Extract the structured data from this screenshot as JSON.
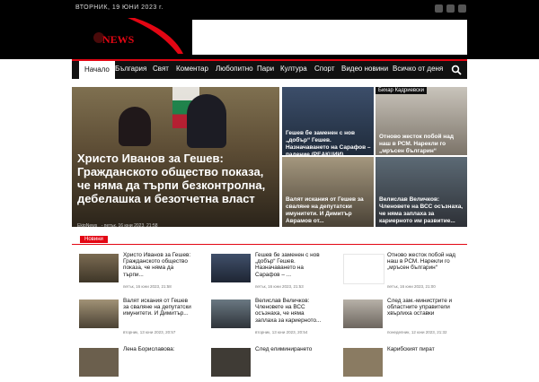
{
  "topbar": {
    "date_text": "ВТОРНИК, 19 ЮНИ 2023 г."
  },
  "logo": {
    "text": "NEWS"
  },
  "nav": {
    "items": [
      {
        "label": "Начало",
        "active": true
      },
      {
        "label": "България"
      },
      {
        "label": "Свят"
      },
      {
        "label": "Коментар"
      },
      {
        "label": "Любопитно"
      },
      {
        "label": "Пари"
      },
      {
        "label": "Култура"
      },
      {
        "label": "Спорт"
      },
      {
        "label": "Видео новини"
      },
      {
        "label": "Всичко от деня"
      }
    ],
    "search_icon": "search-icon"
  },
  "hero": {
    "main": {
      "title": "Христо Иванов за Гешев: Гражданското общество показа, че няма да търпи безконтролна, дебелашка и безотчетна власт",
      "author": "EkipNews",
      "date": "петък, 16 юни 2023, 21:58"
    },
    "tiles": [
      {
        "title": "Гешев бе заменен с нов „добър“ Гешев. Назначаването на Сарафов – падение (РЕАКЦИИ)"
      },
      {
        "label": "Бихар Кадриевски",
        "title": "Отново жесток побой над наш в РСМ. Нарекли го „мръсен българин“"
      },
      {
        "title": "Валят искания от Гешев за сваляне на депутатски имунитети. И Димитър Аврамов от..."
      },
      {
        "title": "Велислав Величков: Членовете на ВСС осъзнаха, че няма заплаха за кариерното им развитие..."
      }
    ]
  },
  "section": {
    "tag": "Новини"
  },
  "list": [
    {
      "title": "Христо Иванов за Гешев: Гражданското общество показа, че няма да търпи...",
      "date": "петък, 16 юни 2023, 21:58",
      "thumb": "photo"
    },
    {
      "title": "Гешев бе заменен с нов „добър“ Гешев. Назначаването на Сарафов – ...",
      "date": "петък, 16 юни 2023, 21:53",
      "thumb": "photo"
    },
    {
      "title": "Отново жесток побой над наш в РСМ. Нарекли го „мръсен българин“",
      "date": "петък, 16 юни 2023, 21:00",
      "thumb": "blank"
    },
    {
      "title": "Валят искания от Гешев за сваляне на депутатски имунитети. И Димитър...",
      "date": "вторник, 13 юни 2023, 20:57",
      "thumb": "photo"
    },
    {
      "title": "Велислав Величков: Членовете на ВСС осъзнаха, че няма заплаха за кариерното...",
      "date": "вторник, 13 юни 2023, 20:54",
      "thumb": "photo"
    },
    {
      "title": "След зам.-министрите и областните управители хвърлиха оставки",
      "date": "понеделник, 12 юни 2023, 21:32",
      "thumb": "photo"
    },
    {
      "title": "Лена Бориславова:",
      "date": "",
      "thumb": "photo"
    },
    {
      "title": "След елиминирането",
      "date": "",
      "thumb": "photo"
    },
    {
      "title": "Карибският пират",
      "date": "",
      "thumb": "photo"
    }
  ]
}
